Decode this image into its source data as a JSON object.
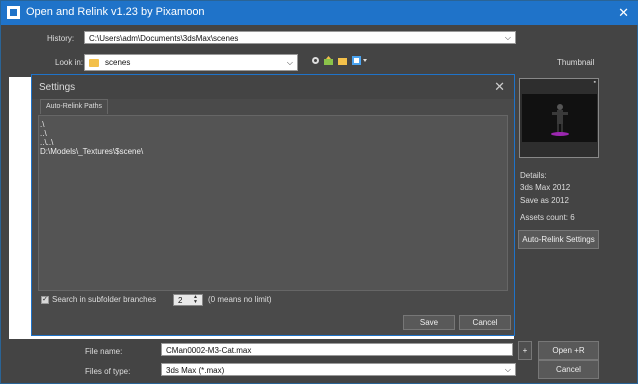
{
  "window": {
    "title": "Open and Relink   v1.23   by Pixamoon",
    "close": "✕"
  },
  "history": {
    "label": "History:",
    "value": "C:\\Users\\adm\\Documents\\3dsMax\\scenes"
  },
  "look_in": {
    "label": "Look in:",
    "value": "scenes"
  },
  "thumbnail": {
    "label": "Thumbnail"
  },
  "details": {
    "heading": "Details:",
    "version": "3ds Max 2012",
    "save_as": "Save as 2012",
    "assets": "Assets count: 6"
  },
  "auto_relink_button": "Auto-Relink Settings",
  "file_name": {
    "label": "File name:",
    "value": "CMan0002-M3-Cat.max"
  },
  "files_of_type": {
    "label": "Files of type:",
    "value": "3ds Max (*.max)"
  },
  "plus_button": "+",
  "open_button": "Open +R",
  "cancel_button": "Cancel",
  "settings": {
    "title": "Settings",
    "close": "✕",
    "tab": "Auto-Relink Paths",
    "paths": [
      ".\\",
      "..\\",
      "..\\..\\",
      "D:\\Models\\_Textures\\$scene\\"
    ],
    "subfolder_label": "Search in subfolder branches",
    "subfolder_checked": "✓",
    "depth_value": "2",
    "depth_hint": "(0 means no limit)",
    "save": "Save",
    "cancel": "Cancel"
  },
  "colors": {
    "titlebar": "#1f73c9",
    "panel": "#444444",
    "accent_border": "#1f73c9"
  }
}
